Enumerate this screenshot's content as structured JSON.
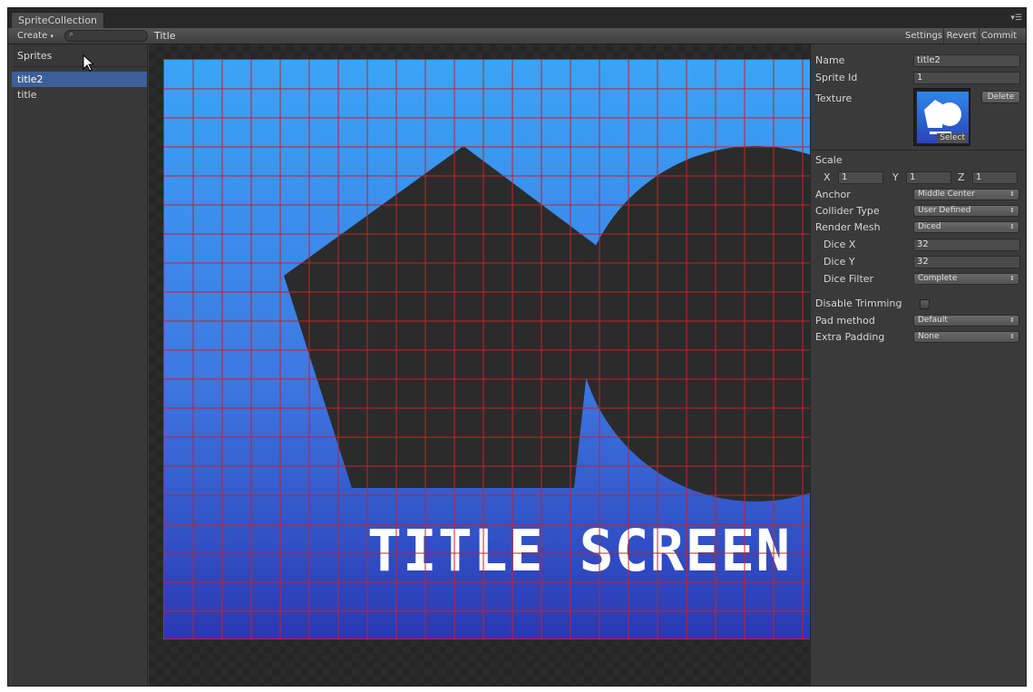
{
  "window": {
    "tab_label": "SpriteCollection"
  },
  "toolbar": {
    "create_label": "Create",
    "create_arrow": "▾",
    "search_placeholder": "",
    "title": "Title",
    "settings_label": "Settings",
    "revert_label": "Revert",
    "commit_label": "Commit"
  },
  "sidebar": {
    "heading": "Sprites",
    "items": [
      {
        "label": "title2",
        "selected": true
      },
      {
        "label": "title",
        "selected": false
      }
    ]
  },
  "preview": {
    "text": "TITLE SCREEN",
    "grid_color": "#c8202a",
    "shape_color": "#2b2b2b",
    "gradient_top": "#3aa4f6",
    "gradient_bottom": "#2a38b4"
  },
  "inspector": {
    "name_label": "Name",
    "name_value": "title2",
    "sprite_id_label": "Sprite Id",
    "sprite_id_value": "1",
    "texture_label": "Texture",
    "texture_select_label": "Select",
    "texture_delete_label": "Delete",
    "scale_label": "Scale",
    "scale_x_label": "X",
    "scale_x_value": "1",
    "scale_y_label": "Y",
    "scale_y_value": "1",
    "scale_z_label": "Z",
    "scale_z_value": "1",
    "anchor_label": "Anchor",
    "anchor_value": "Middle Center",
    "collider_type_label": "Collider Type",
    "collider_type_value": "User Defined",
    "render_mesh_label": "Render Mesh",
    "render_mesh_value": "Diced",
    "dice_x_label": "Dice X",
    "dice_x_value": "32",
    "dice_y_label": "Dice Y",
    "dice_y_value": "32",
    "dice_filter_label": "Dice Filter",
    "dice_filter_value": "Complete",
    "disable_trimming_label": "Disable Trimming",
    "disable_trimming_checked": false,
    "pad_method_label": "Pad method",
    "pad_method_value": "Default",
    "extra_padding_label": "Extra Padding",
    "extra_padding_value": "None",
    "dropdown_arrow": "⇕"
  }
}
